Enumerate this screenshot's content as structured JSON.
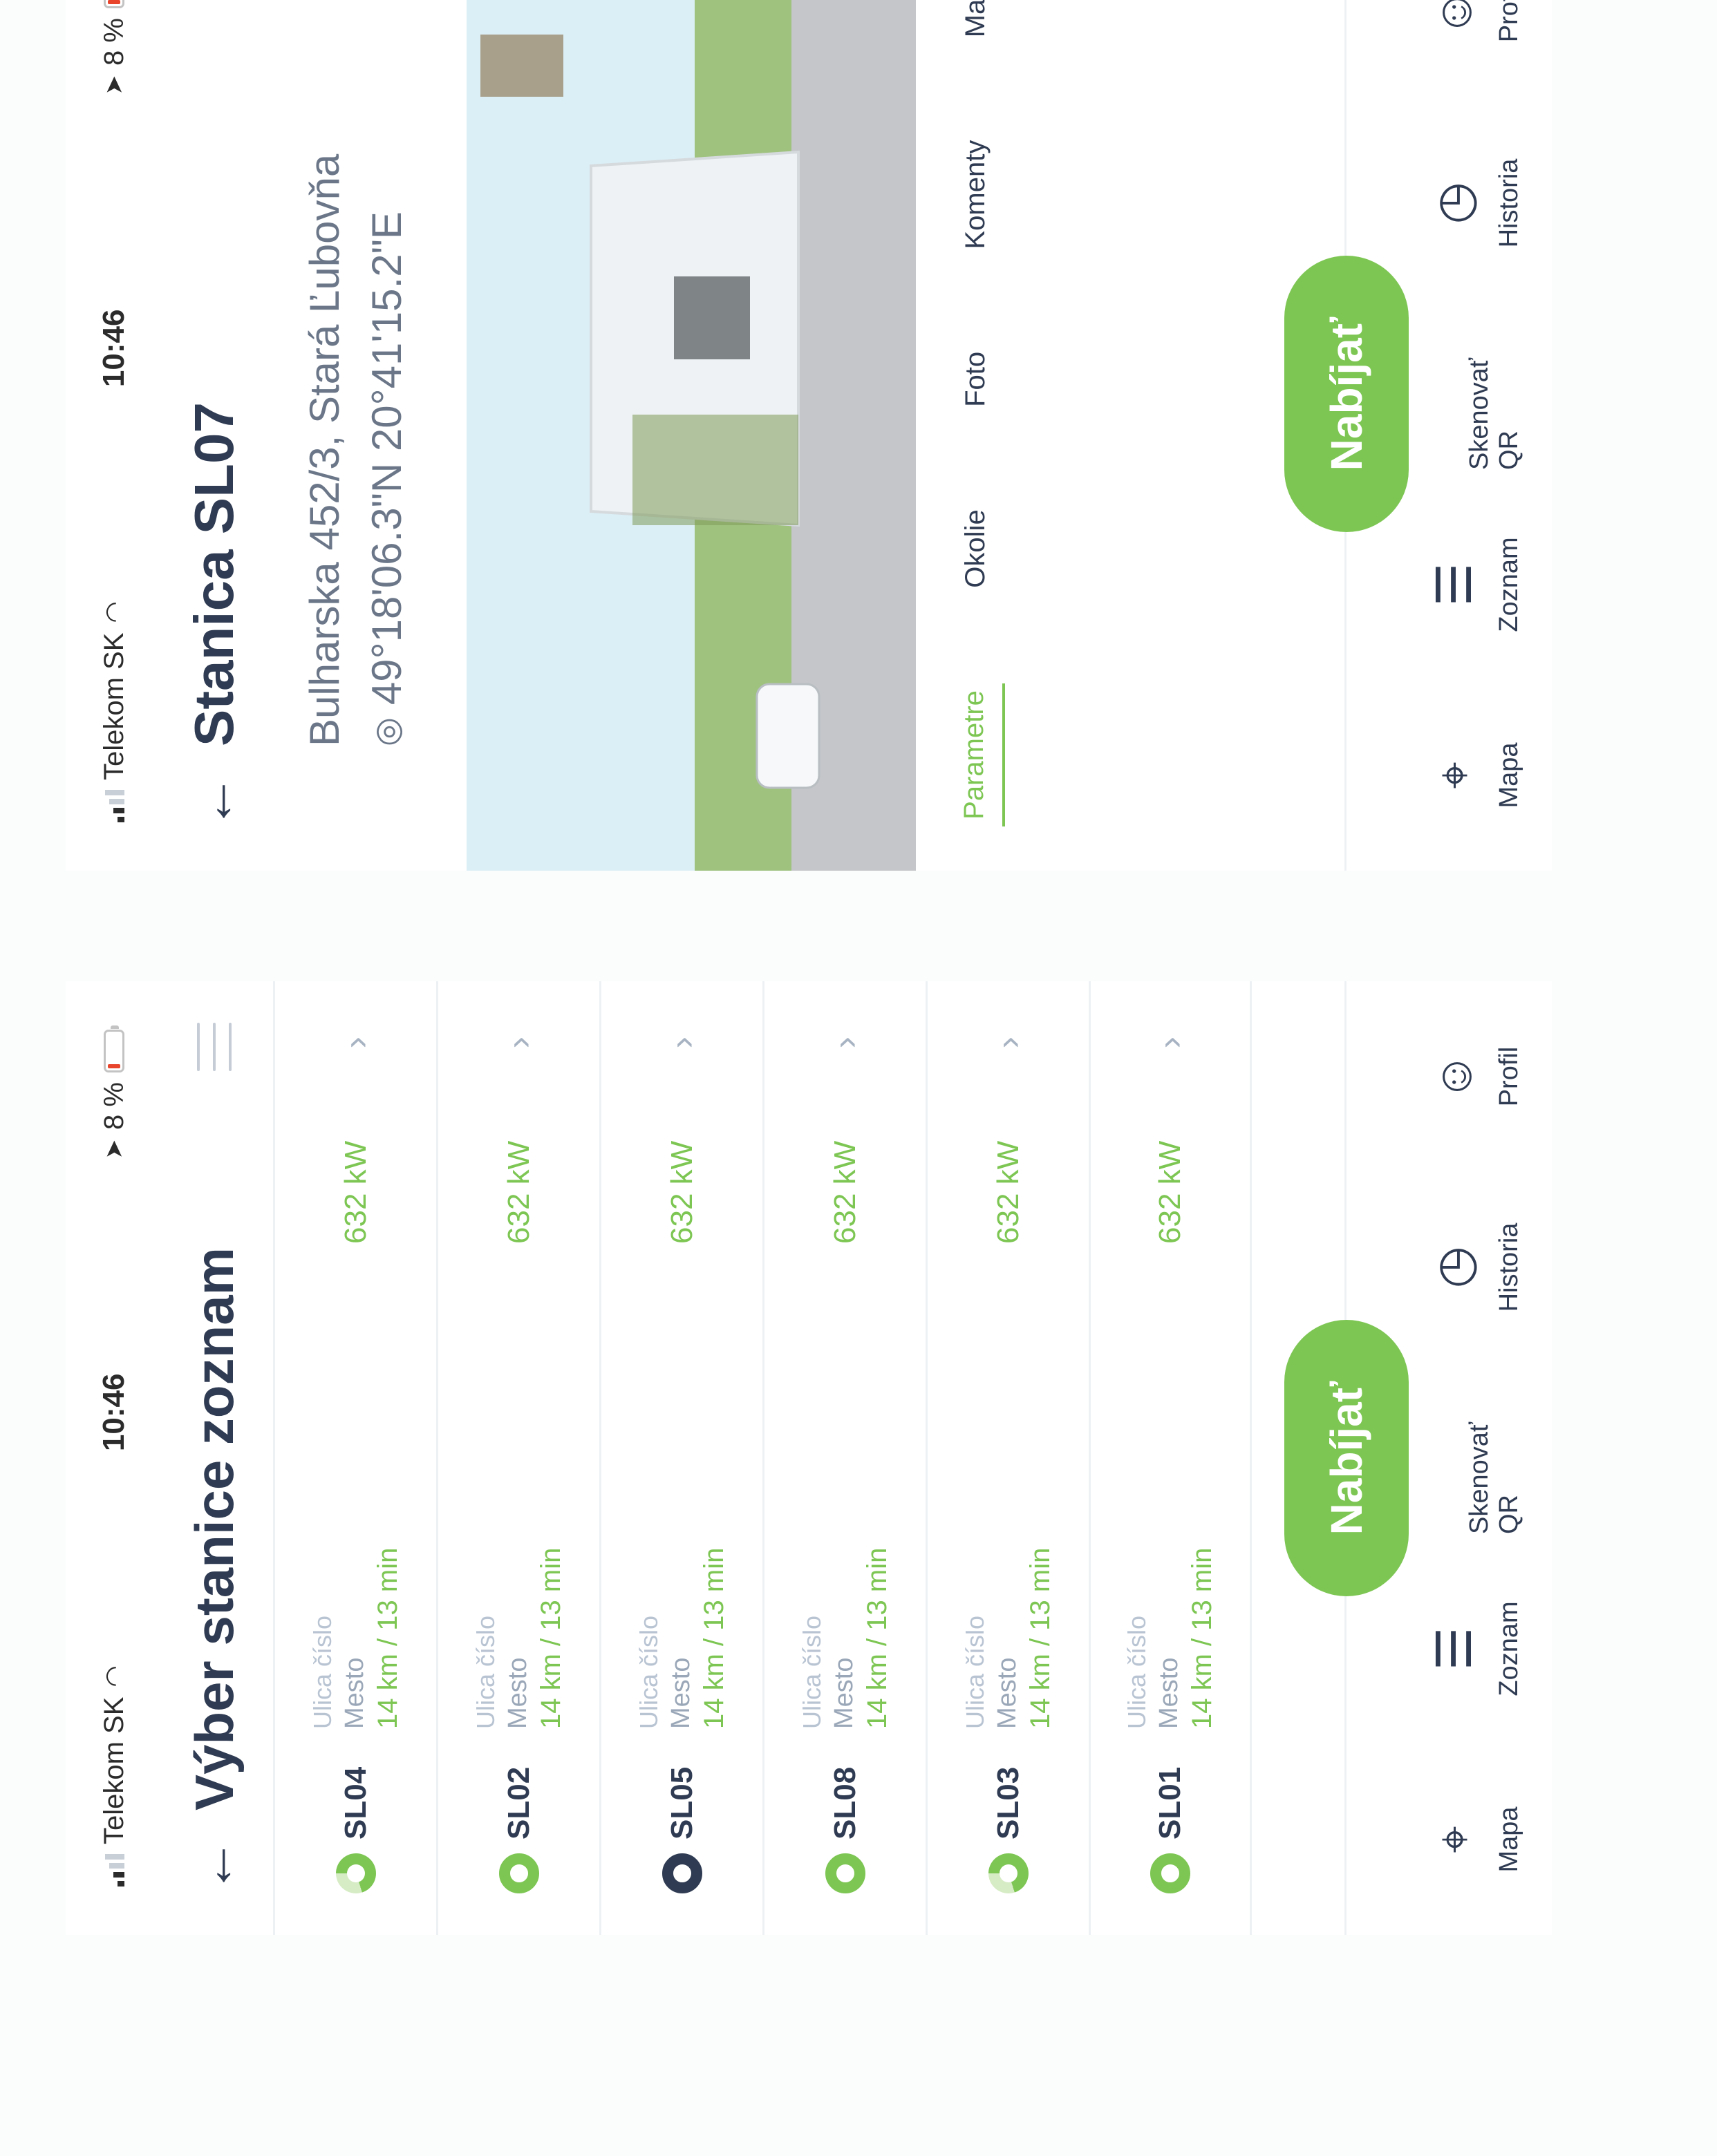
{
  "status_bar": {
    "carrier": "Telekom SK",
    "time": "10:46",
    "battery": "8 %"
  },
  "list_screen": {
    "title": "Výber stanice zoznam",
    "rows": [
      {
        "code": "SL04",
        "street": "Ulica číslo",
        "city": "Mesto",
        "distance": "14 km / 13 min",
        "power": "632 kW",
        "status": "partial"
      },
      {
        "code": "SL02",
        "street": "Ulica číslo",
        "city": "Mesto",
        "distance": "14 km / 13 min",
        "power": "632 kW",
        "status": "available"
      },
      {
        "code": "SL05",
        "street": "Ulica číslo",
        "city": "Mesto",
        "distance": "14 km / 13 min",
        "power": "632 kW",
        "status": "offline"
      },
      {
        "code": "SL08",
        "street": "Ulica číslo",
        "city": "Mesto",
        "distance": "14 km / 13 min",
        "power": "632 kW",
        "status": "available"
      },
      {
        "code": "SL03",
        "street": "Ulica číslo",
        "city": "Mesto",
        "distance": "14 km / 13 min",
        "power": "632 kW",
        "status": "partial"
      },
      {
        "code": "SL01",
        "street": "Ulica číslo",
        "city": "Mesto",
        "distance": "14 km / 13 min",
        "power": "632 kW",
        "status": "available"
      }
    ]
  },
  "detail_screen": {
    "title": "Stanica SL07",
    "address": "Bulharska 452/3, Stará Ľubovňa",
    "gps": "49°18'06.3\"N 20°41'15.2\"E",
    "tabs": [
      "Parametre",
      "Okolie",
      "Foto",
      "Komenty",
      "Mapa"
    ],
    "active_tab": "Parametre"
  },
  "bottom_nav": {
    "items": [
      "Mapa",
      "Zoznam",
      "Skenovať QR",
      "Historia",
      "Profil"
    ],
    "charge_button": "Nabíjať"
  },
  "colors": {
    "accent": "#7dc653",
    "text_dark": "#2f3b52",
    "muted": "#9aa7b8"
  }
}
